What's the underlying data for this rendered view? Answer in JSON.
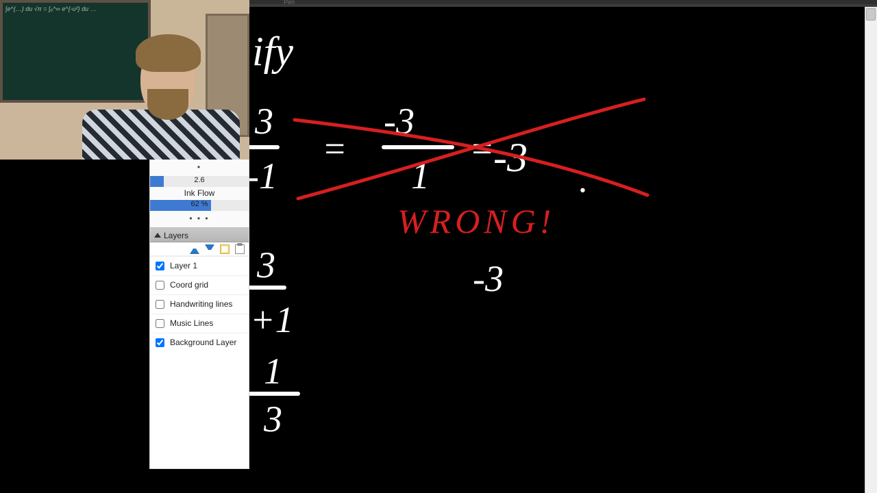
{
  "app": {
    "active_tool_tab": "Pen"
  },
  "tool_panel": {
    "slider1_value": "2.6",
    "slider1_fill_pct": 14,
    "ink_flow_label": "Ink Flow",
    "slider2_value": "62 %",
    "slider2_fill_pct": 62,
    "more": "• • •",
    "dot": "•"
  },
  "layers": {
    "title": "Layers",
    "items": [
      {
        "label": "Layer 1",
        "checked": true
      },
      {
        "label": "Coord grid",
        "checked": false
      },
      {
        "label": "Handwriting lines",
        "checked": false
      },
      {
        "label": "Music Lines",
        "checked": false
      },
      {
        "label": "Background Layer",
        "checked": true
      }
    ]
  },
  "canvas_writing": {
    "top_word_fragment": "ify",
    "row1_left_num": "3",
    "row1_mid_num": "-3",
    "row1_right_num": "-3",
    "row1_denom_left": "-1",
    "row1_denom_mid": "1",
    "row1_equals": "=",
    "row1_equals2": "=",
    "dot_end": ".",
    "wrong_label": "WRONG!",
    "row2_left_num": "3",
    "row2_left_plus1": "+1",
    "row2_right_num": "-3",
    "frac3_num": "1",
    "frac3_den": "3"
  },
  "webcam": {
    "chalkboard_scribbles": "∫e^{…} du   √π = ∫₀^∞ e^{-u²} du …"
  }
}
